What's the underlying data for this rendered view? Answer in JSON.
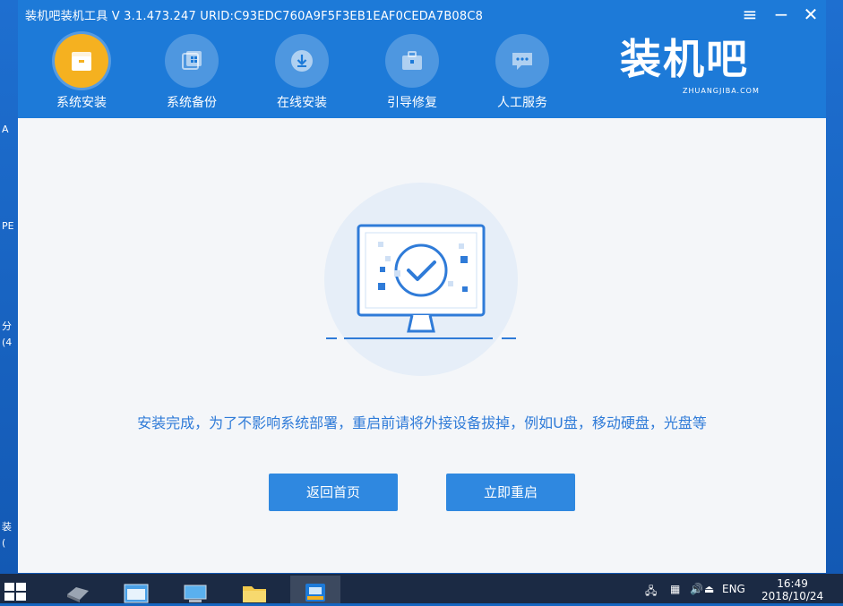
{
  "window": {
    "title": "装机吧装机工具 V 3.1.473.247 URID:C93EDC760A9F5F3EB1EAF0CEDA7B08C8"
  },
  "toolbar": {
    "tools": [
      {
        "label": "系统安装",
        "icon": "install-icon",
        "active": true
      },
      {
        "label": "系统备份",
        "icon": "backup-icon",
        "active": false
      },
      {
        "label": "在线安装",
        "icon": "download-icon",
        "active": false
      },
      {
        "label": "引导修复",
        "icon": "toolbox-icon",
        "active": false
      },
      {
        "label": "人工服务",
        "icon": "chat-icon",
        "active": false
      }
    ]
  },
  "logo": {
    "main": "装机吧",
    "sub": "ZHUANGJIBA.COM"
  },
  "content": {
    "message": "安装完成，为了不影响系统部署，重启前请将外接设备拔掉，例如U盘，移动硬盘，光盘等",
    "back_button": "返回首页",
    "restart_button": "立即重启"
  },
  "desktop_fragments": [
    "A",
    "PE",
    "分",
    "(4",
    "装",
    "("
  ],
  "taskbar": {
    "language": "ENG",
    "clock_time": "16:49",
    "clock_date": "2018/10/24"
  },
  "colors": {
    "title_blue": "#1d7ad8",
    "accent_yellow": "#f5b120",
    "button_blue": "#2f88e0",
    "message_blue": "#2f7bd8"
  }
}
